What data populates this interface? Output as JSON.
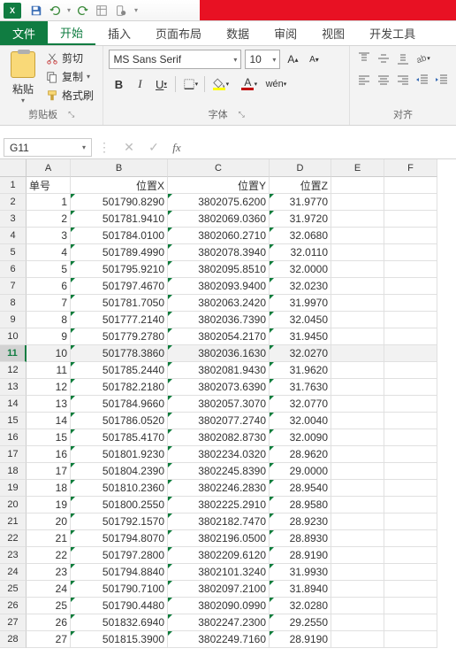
{
  "qat": {
    "app_icon_text": "X"
  },
  "tabs": {
    "file": "文件",
    "items": [
      "开始",
      "插入",
      "页面布局",
      "数据",
      "审阅",
      "视图",
      "开发工具"
    ],
    "active": 0
  },
  "ribbon": {
    "clipboard": {
      "paste": "粘贴",
      "cut": "剪切",
      "copy": "复制",
      "format_painter": "格式刷",
      "group_label": "剪贴板"
    },
    "font": {
      "name": "MS Sans Serif",
      "size": "10",
      "group_label": "字体"
    },
    "align": {
      "group_label": "对齐"
    }
  },
  "namebox": "G11",
  "columns": [
    "A",
    "B",
    "C",
    "D",
    "E",
    "F"
  ],
  "headers": {
    "A": "单号",
    "B": "位置X",
    "C": "位置Y",
    "D": "位置Z"
  },
  "selected_row_index": 10,
  "rows": [
    {
      "n": 1,
      "a": "1",
      "b": "501790.8290",
      "c": "3802075.6200",
      "d": "31.9770"
    },
    {
      "n": 2,
      "a": "2",
      "b": "501781.9410",
      "c": "3802069.0360",
      "d": "31.9720"
    },
    {
      "n": 3,
      "a": "3",
      "b": "501784.0100",
      "c": "3802060.2710",
      "d": "32.0680"
    },
    {
      "n": 4,
      "a": "4",
      "b": "501789.4990",
      "c": "3802078.3940",
      "d": "32.0110"
    },
    {
      "n": 5,
      "a": "5",
      "b": "501795.9210",
      "c": "3802095.8510",
      "d": "32.0000"
    },
    {
      "n": 6,
      "a": "6",
      "b": "501797.4670",
      "c": "3802093.9400",
      "d": "32.0230"
    },
    {
      "n": 7,
      "a": "7",
      "b": "501781.7050",
      "c": "3802063.2420",
      "d": "31.9970"
    },
    {
      "n": 8,
      "a": "8",
      "b": "501777.2140",
      "c": "3802036.7390",
      "d": "32.0450"
    },
    {
      "n": 9,
      "a": "9",
      "b": "501779.2780",
      "c": "3802054.2170",
      "d": "31.9450"
    },
    {
      "n": 10,
      "a": "10",
      "b": "501778.3860",
      "c": "3802036.1630",
      "d": "32.0270"
    },
    {
      "n": 11,
      "a": "11",
      "b": "501785.2440",
      "c": "3802081.9430",
      "d": "31.9620"
    },
    {
      "n": 12,
      "a": "12",
      "b": "501782.2180",
      "c": "3802073.6390",
      "d": "31.7630"
    },
    {
      "n": 13,
      "a": "13",
      "b": "501784.9660",
      "c": "3802057.3070",
      "d": "32.0770"
    },
    {
      "n": 14,
      "a": "14",
      "b": "501786.0520",
      "c": "3802077.2740",
      "d": "32.0040"
    },
    {
      "n": 15,
      "a": "15",
      "b": "501785.4170",
      "c": "3802082.8730",
      "d": "32.0090"
    },
    {
      "n": 16,
      "a": "16",
      "b": "501801.9230",
      "c": "3802234.0320",
      "d": "28.9620"
    },
    {
      "n": 17,
      "a": "17",
      "b": "501804.2390",
      "c": "3802245.8390",
      "d": "29.0000"
    },
    {
      "n": 18,
      "a": "18",
      "b": "501810.2360",
      "c": "3802246.2830",
      "d": "28.9540"
    },
    {
      "n": 19,
      "a": "19",
      "b": "501800.2550",
      "c": "3802225.2910",
      "d": "28.9580"
    },
    {
      "n": 20,
      "a": "20",
      "b": "501792.1570",
      "c": "3802182.7470",
      "d": "28.9230"
    },
    {
      "n": 21,
      "a": "21",
      "b": "501794.8070",
      "c": "3802196.0500",
      "d": "28.8930"
    },
    {
      "n": 22,
      "a": "22",
      "b": "501797.2800",
      "c": "3802209.6120",
      "d": "28.9190"
    },
    {
      "n": 23,
      "a": "23",
      "b": "501794.8840",
      "c": "3802101.3240",
      "d": "31.9930"
    },
    {
      "n": 24,
      "a": "24",
      "b": "501790.7100",
      "c": "3802097.2100",
      "d": "31.8940"
    },
    {
      "n": 25,
      "a": "25",
      "b": "501790.4480",
      "c": "3802090.0990",
      "d": "32.0280"
    },
    {
      "n": 26,
      "a": "26",
      "b": "501832.6940",
      "c": "3802247.2300",
      "d": "29.2550"
    },
    {
      "n": 27,
      "a": "27",
      "b": "501815.3900",
      "c": "3802249.7160",
      "d": "28.9190"
    }
  ]
}
